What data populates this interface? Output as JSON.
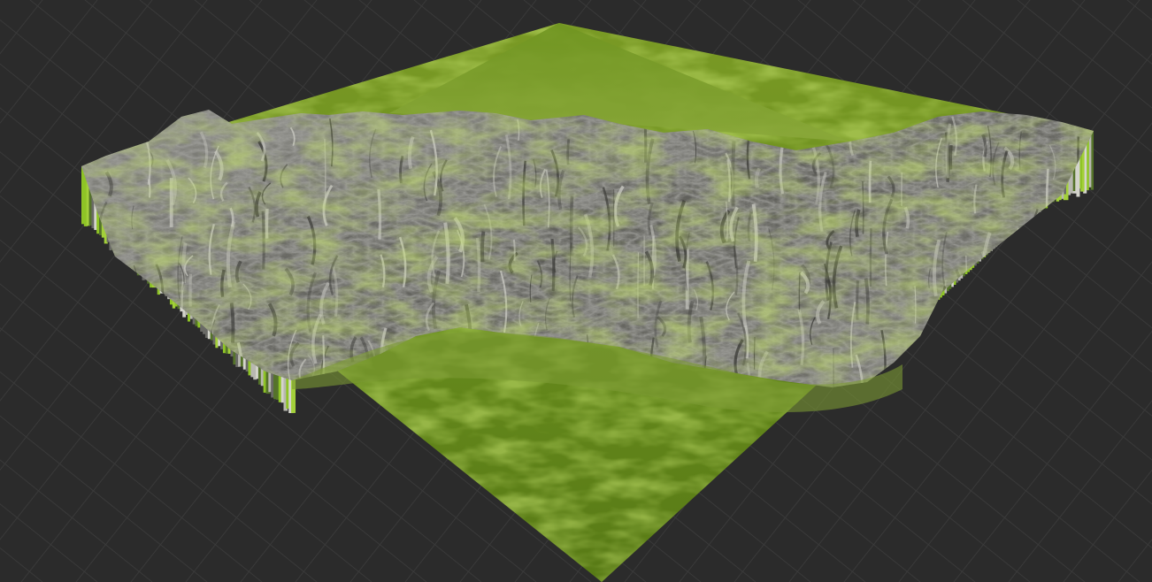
{
  "viewport": {
    "name": "3d-terrain-viewport",
    "background_color": "#2b2b2b",
    "grid_color": "#3a3a3a",
    "grid_visible": true
  },
  "terrain": {
    "model": "mountain-range-terrain",
    "ground_color": "#6b8e1f",
    "ground_shadow_color": "#4f6d14",
    "rock_color": "#6e6e6a",
    "rock_highlight_color": "#c9c9c2",
    "vegetation_color": "#8dbb2a",
    "side_wall_colors": [
      "#8fc426",
      "#b8b8b0",
      "#6a6a66",
      "#a3d03a",
      "#d4d4cc",
      "#55732a"
    ]
  }
}
